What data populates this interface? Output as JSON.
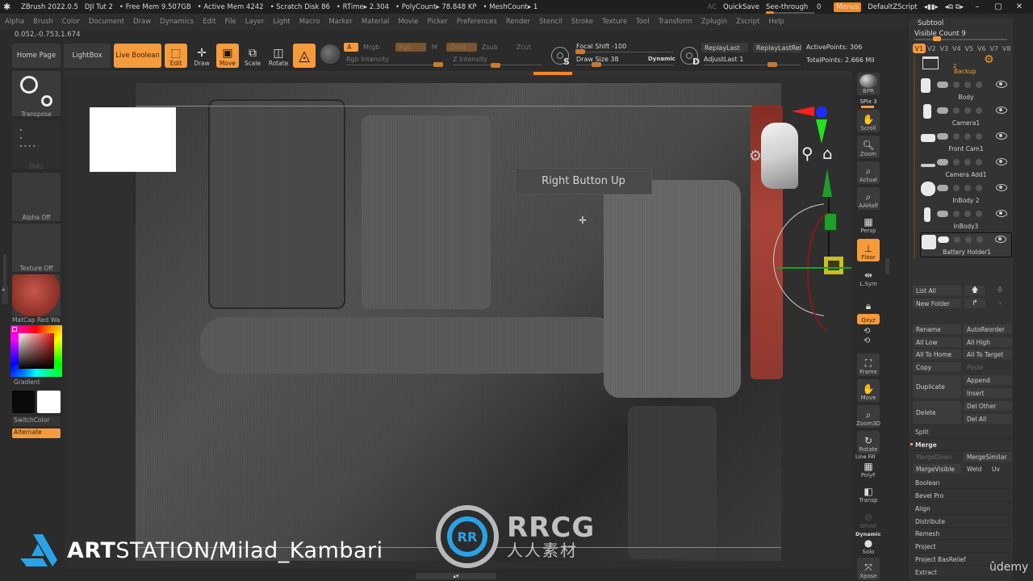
{
  "titlebar": {
    "app": "ZBrush 2022.0.5",
    "document": "DJI Tut 2",
    "stats": [
      "• Free Mem 9.507GB",
      "• Active Mem 4242",
      "• Scratch Disk 86",
      "• RTime▸ 2.304",
      "• PolyCount▸ 78.848 KP",
      "• MeshCount▸ 1"
    ],
    "ac": "AC",
    "quicksave": "QuickSave",
    "see_through_label": "See-through",
    "see_through_value": "0",
    "see_through_fraction": 0.0,
    "menus": "Menus",
    "default_zscript": "DefaultZScript",
    "window_controls": [
      "–",
      "▢",
      "✕"
    ]
  },
  "menubar": [
    "Alpha",
    "Brush",
    "Color",
    "Document",
    "Draw",
    "Dynamics",
    "Edit",
    "File",
    "Layer",
    "Light",
    "Macro",
    "Marker",
    "Material",
    "Movie",
    "Picker",
    "Preferences",
    "Render",
    "Stencil",
    "Stroke",
    "Texture",
    "Tool",
    "Transform",
    "Zplugin",
    "Zscript",
    "Help"
  ],
  "coords": "0.052,-0.753,1.674",
  "toolbar": {
    "home_page": "Home Page",
    "lightbox": "LightBox",
    "live_boolean": "Live Boolean",
    "edit": "Edit",
    "draw": "Draw",
    "move": "Move",
    "scale": "Scale",
    "rotate": "Rotate",
    "a": "A",
    "mrgb": "Mrgb",
    "rgb": "Rgb",
    "m": "M",
    "zadd": "Zadd",
    "zsub": "Zsub",
    "zcut": "Zcut",
    "rgb_intensity": "Rgb Intensity",
    "z_intensity": "Z Intensity",
    "focal_shift": "Focal Shift -100",
    "draw_size": "Draw Size 38",
    "dynamic": "Dynamic",
    "s_letter": "S",
    "d_letter": "D",
    "replay_last": "ReplayLast",
    "replay_last_rel": "ReplayLastRel",
    "adjust_last": "AdjustLast 1",
    "active_points": "ActivePoints: 306",
    "total_points": "TotalPoints: 2.666 Mil"
  },
  "left_shelf": {
    "transpose": "Transpose",
    "dots": "Dots",
    "alpha_off": "Alpha Off",
    "texture_off": "Texture Off",
    "material": "MatCap Red Wax",
    "gradient": "Gradient",
    "switch_color": "SwitchColor",
    "alternate": "Alternate",
    "colors": {
      "primary": "#0a0a0a",
      "secondary": "#ffffff",
      "material": "#b5473a"
    }
  },
  "canvas": {
    "tooltip": "Right Button Up"
  },
  "right_shelf": [
    {
      "label": "BPR",
      "icon": "bpr-icon"
    },
    {
      "label": "SPix 3",
      "icon": "spix-slider"
    },
    {
      "label": "Scroll",
      "icon": "hand-scroll-icon"
    },
    {
      "label": "Zoom",
      "icon": "magnifier-icon"
    },
    {
      "label": "Actual",
      "icon": "magnifier-actual-icon"
    },
    {
      "label": "AAHalf",
      "icon": "magnifier-half-icon"
    },
    {
      "label": "Persp",
      "icon": "perspective-grid-icon"
    },
    {
      "label": "Floor",
      "icon": "floor-icon"
    },
    {
      "label": "L.Sym",
      "icon": "local-symmetry-icon"
    },
    {
      "label": "",
      "icon": "lock-camera-icon"
    },
    {
      "label": "Qxyz",
      "icon": "xyz-rotate-icon"
    },
    {
      "label": "Frame",
      "icon": "frame-icon"
    },
    {
      "label": "Move",
      "icon": "hand-move-icon"
    },
    {
      "label": "Zoom3D",
      "icon": "zoom3d-icon"
    },
    {
      "label": "Rotate",
      "icon": "rotate-icon"
    },
    {
      "label": "PolyF",
      "icon": "polyframe-icon"
    },
    {
      "label": "Transp",
      "icon": "transparency-icon"
    },
    {
      "label": "Ghost",
      "icon": "ghost-icon"
    },
    {
      "label": "Solo",
      "icon": "solo-icon"
    },
    {
      "label": "Xpose",
      "icon": "xpose-icon"
    }
  ],
  "right_shelf_extra": {
    "line_fill": "Line Fill",
    "dynamic": "Dynamic"
  },
  "subtool": {
    "title": "Subtool",
    "visible_count": "Visible Count 9",
    "visible_count_fraction": 0.22,
    "versions": [
      "V1",
      "V2",
      "V3",
      "V4",
      "V5",
      "V6",
      "V7",
      "V8"
    ],
    "active_version": "V1",
    "backup_label": "Backup",
    "backup_count": "2",
    "items": [
      {
        "name": "Body"
      },
      {
        "name": "Camera1"
      },
      {
        "name": "Front Cam1"
      },
      {
        "name": "Camera Add1"
      },
      {
        "name": "InBody 2"
      },
      {
        "name": "InBody3"
      },
      {
        "name": "Battery Holder1",
        "selected": true
      }
    ],
    "list_all": "List All",
    "new_folder": "New Folder",
    "buttons": {
      "rename": "Rename",
      "autoreorder": "AutoReorder",
      "all_low": "All Low",
      "all_high": "All High",
      "all_to_home": "All To Home",
      "all_to_target": "All To Target",
      "copy": "Copy",
      "paste": "Paste",
      "duplicate": "Duplicate",
      "append": "Append",
      "insert": "Insert",
      "delete": "Delete",
      "del_other": "Del Other",
      "del_all": "Del All",
      "split": "Split",
      "merge": "Merge",
      "merge_down": "MergeDown",
      "merge_similar": "MergeSimilar",
      "merge_visible": "MergeVisible",
      "weld": "Weld",
      "uv": "Uv"
    },
    "sections": [
      "Boolean",
      "Bevel Pro",
      "Align",
      "Distribute",
      "Remesh",
      "Project",
      "Project BasRelief",
      "Extract"
    ]
  },
  "watermarks": {
    "artstation_bold": "ART",
    "artstation_rest": "STATION/Milad_Kambari",
    "rrcg": "RRCG",
    "rrcg_cn": "人人素材",
    "rrcg_mark": "RR",
    "udemy": "ûdemy"
  },
  "colors": {
    "accent": "#f59b3c",
    "panel": "#333333",
    "background": "#2b2b2b"
  }
}
